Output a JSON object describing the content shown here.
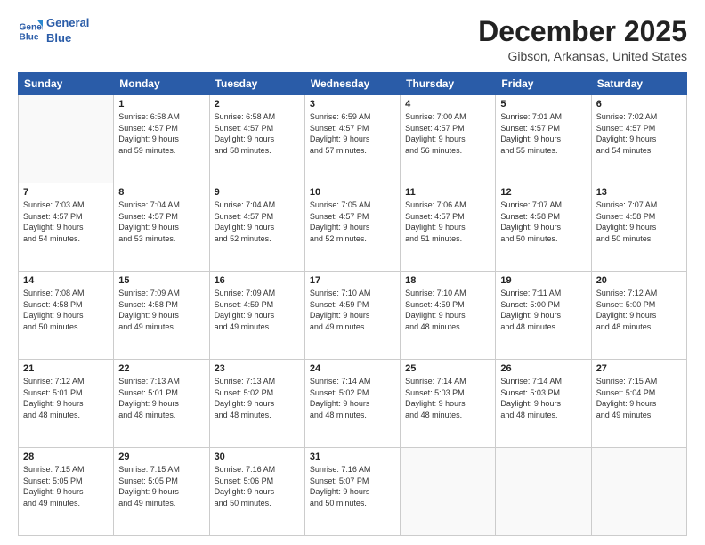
{
  "logo": {
    "line1": "General",
    "line2": "Blue"
  },
  "title": "December 2025",
  "subtitle": "Gibson, Arkansas, United States",
  "days_of_week": [
    "Sunday",
    "Monday",
    "Tuesday",
    "Wednesday",
    "Thursday",
    "Friday",
    "Saturday"
  ],
  "weeks": [
    [
      {
        "day": "",
        "info": ""
      },
      {
        "day": "1",
        "info": "Sunrise: 6:58 AM\nSunset: 4:57 PM\nDaylight: 9 hours\nand 59 minutes."
      },
      {
        "day": "2",
        "info": "Sunrise: 6:58 AM\nSunset: 4:57 PM\nDaylight: 9 hours\nand 58 minutes."
      },
      {
        "day": "3",
        "info": "Sunrise: 6:59 AM\nSunset: 4:57 PM\nDaylight: 9 hours\nand 57 minutes."
      },
      {
        "day": "4",
        "info": "Sunrise: 7:00 AM\nSunset: 4:57 PM\nDaylight: 9 hours\nand 56 minutes."
      },
      {
        "day": "5",
        "info": "Sunrise: 7:01 AM\nSunset: 4:57 PM\nDaylight: 9 hours\nand 55 minutes."
      },
      {
        "day": "6",
        "info": "Sunrise: 7:02 AM\nSunset: 4:57 PM\nDaylight: 9 hours\nand 54 minutes."
      }
    ],
    [
      {
        "day": "7",
        "info": "Sunrise: 7:03 AM\nSunset: 4:57 PM\nDaylight: 9 hours\nand 54 minutes."
      },
      {
        "day": "8",
        "info": "Sunrise: 7:04 AM\nSunset: 4:57 PM\nDaylight: 9 hours\nand 53 minutes."
      },
      {
        "day": "9",
        "info": "Sunrise: 7:04 AM\nSunset: 4:57 PM\nDaylight: 9 hours\nand 52 minutes."
      },
      {
        "day": "10",
        "info": "Sunrise: 7:05 AM\nSunset: 4:57 PM\nDaylight: 9 hours\nand 52 minutes."
      },
      {
        "day": "11",
        "info": "Sunrise: 7:06 AM\nSunset: 4:57 PM\nDaylight: 9 hours\nand 51 minutes."
      },
      {
        "day": "12",
        "info": "Sunrise: 7:07 AM\nSunset: 4:58 PM\nDaylight: 9 hours\nand 50 minutes."
      },
      {
        "day": "13",
        "info": "Sunrise: 7:07 AM\nSunset: 4:58 PM\nDaylight: 9 hours\nand 50 minutes."
      }
    ],
    [
      {
        "day": "14",
        "info": "Sunrise: 7:08 AM\nSunset: 4:58 PM\nDaylight: 9 hours\nand 50 minutes."
      },
      {
        "day": "15",
        "info": "Sunrise: 7:09 AM\nSunset: 4:58 PM\nDaylight: 9 hours\nand 49 minutes."
      },
      {
        "day": "16",
        "info": "Sunrise: 7:09 AM\nSunset: 4:59 PM\nDaylight: 9 hours\nand 49 minutes."
      },
      {
        "day": "17",
        "info": "Sunrise: 7:10 AM\nSunset: 4:59 PM\nDaylight: 9 hours\nand 49 minutes."
      },
      {
        "day": "18",
        "info": "Sunrise: 7:10 AM\nSunset: 4:59 PM\nDaylight: 9 hours\nand 48 minutes."
      },
      {
        "day": "19",
        "info": "Sunrise: 7:11 AM\nSunset: 5:00 PM\nDaylight: 9 hours\nand 48 minutes."
      },
      {
        "day": "20",
        "info": "Sunrise: 7:12 AM\nSunset: 5:00 PM\nDaylight: 9 hours\nand 48 minutes."
      }
    ],
    [
      {
        "day": "21",
        "info": "Sunrise: 7:12 AM\nSunset: 5:01 PM\nDaylight: 9 hours\nand 48 minutes."
      },
      {
        "day": "22",
        "info": "Sunrise: 7:13 AM\nSunset: 5:01 PM\nDaylight: 9 hours\nand 48 minutes."
      },
      {
        "day": "23",
        "info": "Sunrise: 7:13 AM\nSunset: 5:02 PM\nDaylight: 9 hours\nand 48 minutes."
      },
      {
        "day": "24",
        "info": "Sunrise: 7:14 AM\nSunset: 5:02 PM\nDaylight: 9 hours\nand 48 minutes."
      },
      {
        "day": "25",
        "info": "Sunrise: 7:14 AM\nSunset: 5:03 PM\nDaylight: 9 hours\nand 48 minutes."
      },
      {
        "day": "26",
        "info": "Sunrise: 7:14 AM\nSunset: 5:03 PM\nDaylight: 9 hours\nand 48 minutes."
      },
      {
        "day": "27",
        "info": "Sunrise: 7:15 AM\nSunset: 5:04 PM\nDaylight: 9 hours\nand 49 minutes."
      }
    ],
    [
      {
        "day": "28",
        "info": "Sunrise: 7:15 AM\nSunset: 5:05 PM\nDaylight: 9 hours\nand 49 minutes."
      },
      {
        "day": "29",
        "info": "Sunrise: 7:15 AM\nSunset: 5:05 PM\nDaylight: 9 hours\nand 49 minutes."
      },
      {
        "day": "30",
        "info": "Sunrise: 7:16 AM\nSunset: 5:06 PM\nDaylight: 9 hours\nand 50 minutes."
      },
      {
        "day": "31",
        "info": "Sunrise: 7:16 AM\nSunset: 5:07 PM\nDaylight: 9 hours\nand 50 minutes."
      },
      {
        "day": "",
        "info": ""
      },
      {
        "day": "",
        "info": ""
      },
      {
        "day": "",
        "info": ""
      }
    ]
  ]
}
